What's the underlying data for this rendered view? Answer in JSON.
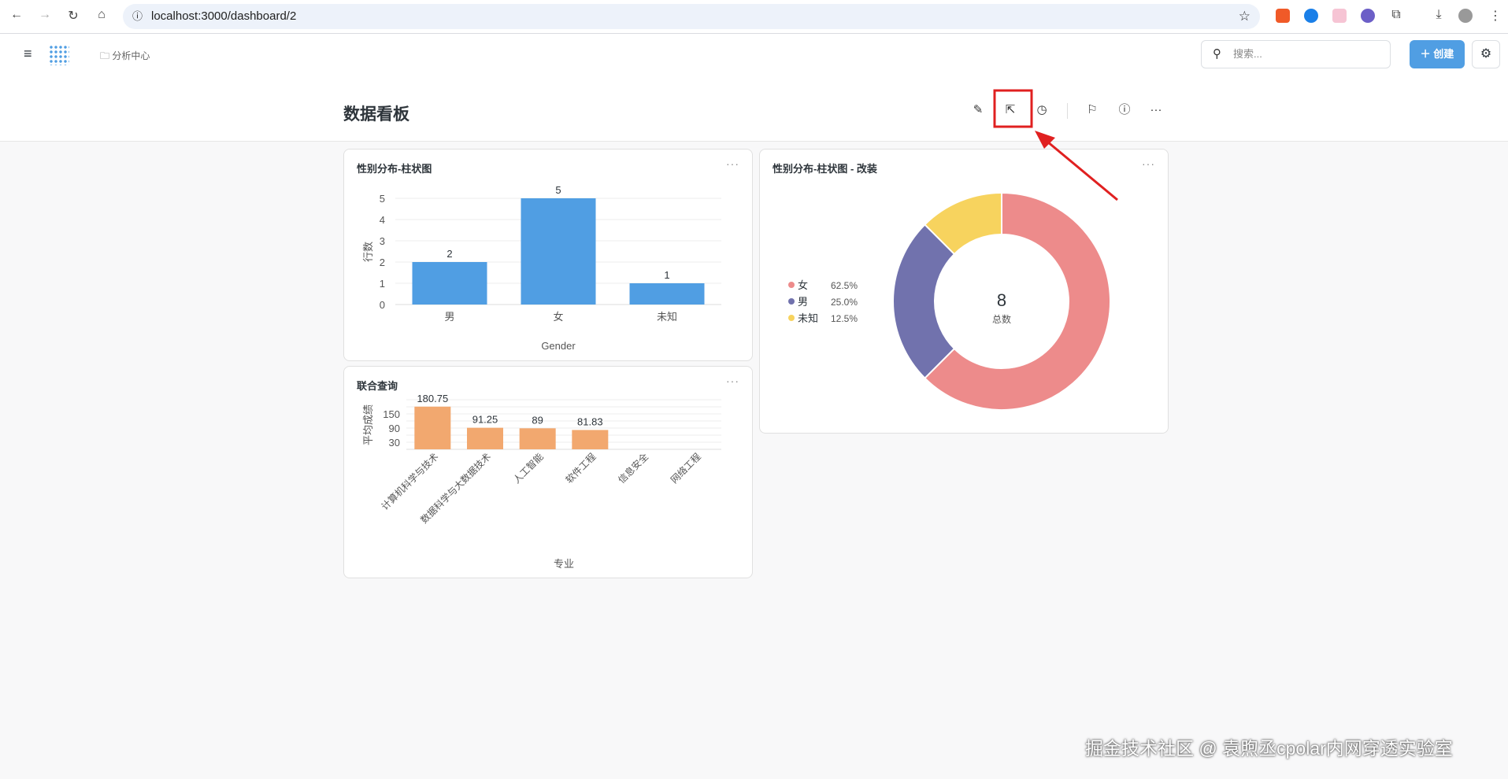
{
  "browser": {
    "url": "localhost:3000/dashboard/2"
  },
  "app": {
    "breadcrumb": "分析中心",
    "search_placeholder": "搜索...",
    "create_label": "创建",
    "create_icon": "plus-icon",
    "settings_icon": "gear-icon"
  },
  "dashboard": {
    "title": "数据看板",
    "tools": [
      "pencil-icon",
      "share-icon",
      "clock-icon",
      "bookmark-icon",
      "info-icon",
      "more-icon"
    ]
  },
  "cards": {
    "gender_bar": {
      "title": "性别分布-柱状图",
      "more": "···"
    },
    "union_query": {
      "title": "联合查询",
      "more": "···"
    },
    "gender_donut": {
      "title": "性别分布-柱状图 - 改装",
      "more": "···"
    }
  },
  "chart_data": [
    {
      "type": "bar",
      "categories": [
        "男",
        "女",
        "未知"
      ],
      "values": [
        2,
        5,
        1
      ],
      "xlabel": "Gender",
      "ylabel": "行数",
      "yticks": [
        0,
        1,
        2,
        3,
        4,
        5
      ],
      "ylim": [
        0,
        5
      ],
      "color": "#509ee3",
      "grid": true
    },
    {
      "type": "bar",
      "categories": [
        "计算机科学与技术",
        "数据科学与大数据技术",
        "人工智能",
        "软件工程",
        "信息安全",
        "网络工程"
      ],
      "values": [
        180.75,
        91.25,
        89,
        81.83,
        null,
        null
      ],
      "labels": [
        "180.75",
        "91.25",
        "89",
        "81.83",
        "",
        ""
      ],
      "xlabel": "专业",
      "ylabel": "平均成绩",
      "yticks": [
        30,
        90,
        150
      ],
      "ylim": [
        0,
        210
      ],
      "color": "#f2a86f",
      "grid": true
    },
    {
      "type": "pie",
      "donut": true,
      "total": "8",
      "total_label": "总数",
      "slices": [
        {
          "label": "女",
          "value": 5,
          "percent": "62.5%",
          "color": "#ed8b8b"
        },
        {
          "label": "男",
          "value": 2,
          "percent": "25.0%",
          "color": "#7172ad"
        },
        {
          "label": "未知",
          "value": 1,
          "percent": "12.5%",
          "color": "#f7d35e"
        }
      ],
      "legend": "left"
    }
  ],
  "annotation": {
    "highlight_color": "#e02020"
  },
  "watermark": "掘金技术社区 @ 袁煦丞cpolar内网穿透实验室"
}
